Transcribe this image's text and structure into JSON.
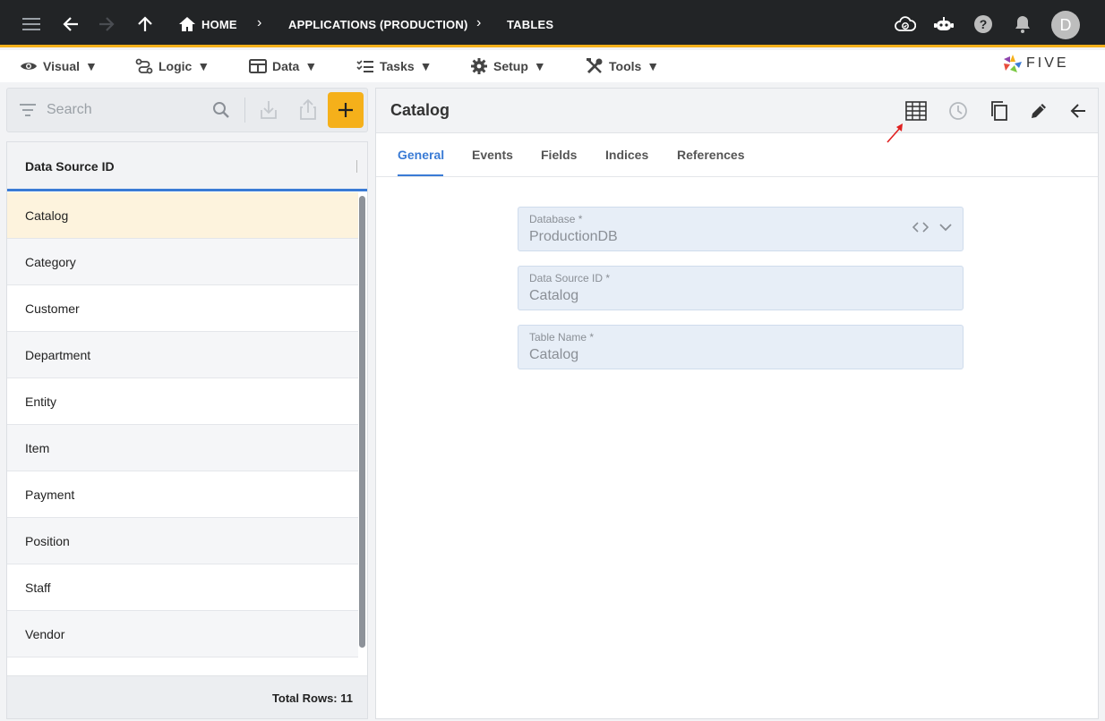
{
  "topbar": {
    "breadcrumbs": [
      "HOME",
      "APPLICATIONS (PRODUCTION)",
      "TABLES"
    ],
    "avatar_letter": "D",
    "icons": [
      "menu-icon",
      "back-arrow-icon",
      "forward-arrow-icon",
      "up-arrow-icon",
      "home-icon",
      "cloud-check-icon",
      "robot-icon",
      "help-icon",
      "bell-icon"
    ]
  },
  "menubar": {
    "items": [
      {
        "label": "Visual",
        "icon": "eye-icon"
      },
      {
        "label": "Logic",
        "icon": "logic-icon"
      },
      {
        "label": "Data",
        "icon": "table-icon"
      },
      {
        "label": "Tasks",
        "icon": "tasks-icon"
      },
      {
        "label": "Setup",
        "icon": "gear-icon"
      },
      {
        "label": "Tools",
        "icon": "tools-icon"
      }
    ],
    "caret": "▼",
    "logo": "FIVE"
  },
  "list": {
    "search_placeholder": "Search",
    "column_header": "Data Source ID",
    "rows": [
      "Catalog",
      "Category",
      "Customer",
      "Department",
      "Entity",
      "Item",
      "Payment",
      "Position",
      "Staff",
      "Vendor"
    ],
    "selected_index": 0,
    "footer": "Total Rows: 11"
  },
  "form": {
    "title": "Catalog",
    "tabs": [
      "General",
      "Events",
      "Fields",
      "Indices",
      "References"
    ],
    "active_tab": "General",
    "fields": [
      {
        "label": "Database *",
        "value": "ProductionDB"
      },
      {
        "label": "Data Source ID *",
        "value": "Catalog"
      },
      {
        "label": "Table Name *",
        "value": "Catalog"
      }
    ]
  },
  "colors": {
    "topbar": "#222426",
    "accent": "#f5b01a",
    "active_tab": "#3a7bd5",
    "annotation_arrow": "#e02020"
  }
}
